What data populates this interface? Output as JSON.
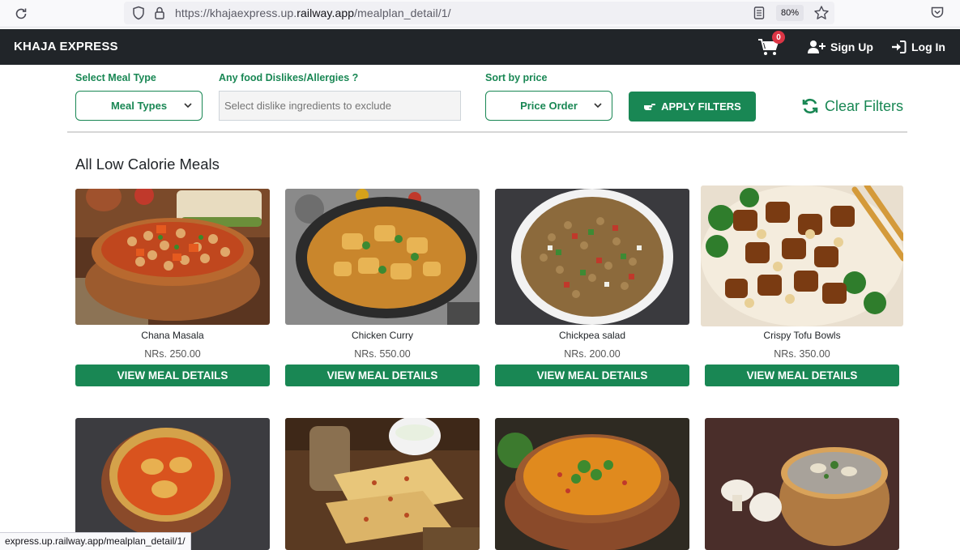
{
  "browser": {
    "url_prefix": "https://khajaexpress.up.",
    "url_domain": "railway.app",
    "url_path": "/mealplan_detail/1/",
    "zoom": "80%",
    "status_url": "express.up.railway.app/mealplan_detail/1/"
  },
  "navbar": {
    "brand": "KHAJA EXPRESS",
    "cart_count": "0",
    "signup": "Sign Up",
    "login": "Log In"
  },
  "filters": {
    "meal_type_label": "Select Meal Type",
    "meal_type_value": "Meal Types",
    "dislikes_label": "Any food Dislikes/Allergies ?",
    "dislikes_placeholder": "Select dislike ingredients to exclude",
    "sort_label": "Sort by price",
    "sort_value": "Price Order",
    "apply": "APPLY FILTERS",
    "clear": "Clear Filters"
  },
  "section_title": "All Low Calorie Meals",
  "meals": [
    {
      "name": "Chana Masala",
      "price": "NRs. 250.00",
      "button": "VIEW MEAL DETAILS"
    },
    {
      "name": "Chicken Curry",
      "price": "NRs. 550.00",
      "button": "VIEW MEAL DETAILS"
    },
    {
      "name": "Chickpea salad",
      "price": "NRs. 200.00",
      "button": "VIEW MEAL DETAILS"
    },
    {
      "name": "Crispy Tofu Bowls",
      "price": "NRs. 350.00",
      "button": "VIEW MEAL DETAILS"
    }
  ],
  "colors": {
    "brand_green": "#198754",
    "navbar": "#212529",
    "badge": "#dc3545"
  }
}
